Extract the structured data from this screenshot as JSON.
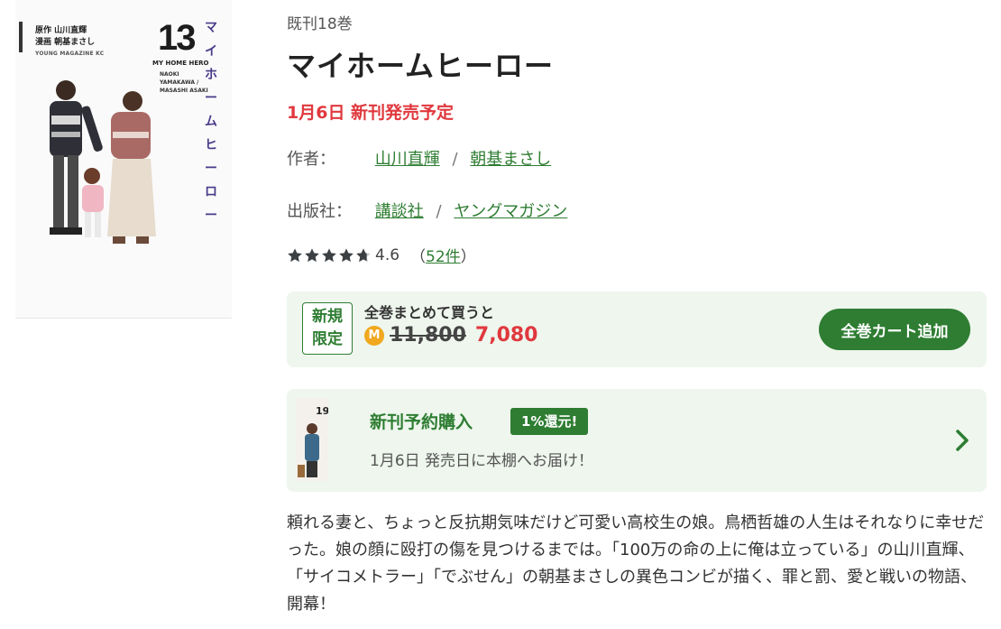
{
  "cover": {
    "original_credit": "原作 山川直輝",
    "art_credit": "漫画 朝基まさし",
    "imprint": "YOUNG MAGAZINE KC",
    "volume": "13",
    "subtitle": "MY HOME HERO",
    "authors_en": "NAOKI YAMAKAWA / MASASHI ASAKI",
    "vertical_title": "マイホームヒーロー"
  },
  "book": {
    "count": "既刊18巻",
    "title": "マイホームヒーロー",
    "release": "1月6日 新刊発売予定",
    "author_label": "作者：",
    "authors": [
      "山川直輝",
      "朝基まさし"
    ],
    "publisher_label": "出版社：",
    "publishers": [
      "講談社",
      "ヤングマガジン"
    ],
    "separator": "/",
    "rating_value": 4.6,
    "rating": "4.6",
    "review_open": "（",
    "review_count": "52件",
    "review_close": "）"
  },
  "bulk": {
    "badge_line1": "新規",
    "badge_line2": "限定",
    "text": "全巻まとめて買うと",
    "coin": "M",
    "old_price": "11,800",
    "new_price": "7,080",
    "cart_button": "全巻カート追加"
  },
  "reserve": {
    "thumb_volume": "19",
    "title": "新刊予約購入",
    "badge": "1%還元!",
    "subtitle": "1月6日 発売日に本棚へお届け！"
  },
  "description": "頼れる妻と、ちょっと反抗期気味だけど可愛い高校生の娘。鳥栖哲雄の人生はそれなりに幸せだった。娘の顔に殴打の傷を見つけるまでは。「100万の命の上に俺は立っている」の山川直輝、「サイコメトラー」「でぶせん」の朝基まさしの異色コンビが描く、罪と罰、愛と戦いの物語、開幕！",
  "colors": {
    "accent_green": "#2e7d32",
    "sale_red": "#e0383e",
    "panel_bg": "#eef6ed",
    "coin": "#f0a81e"
  }
}
